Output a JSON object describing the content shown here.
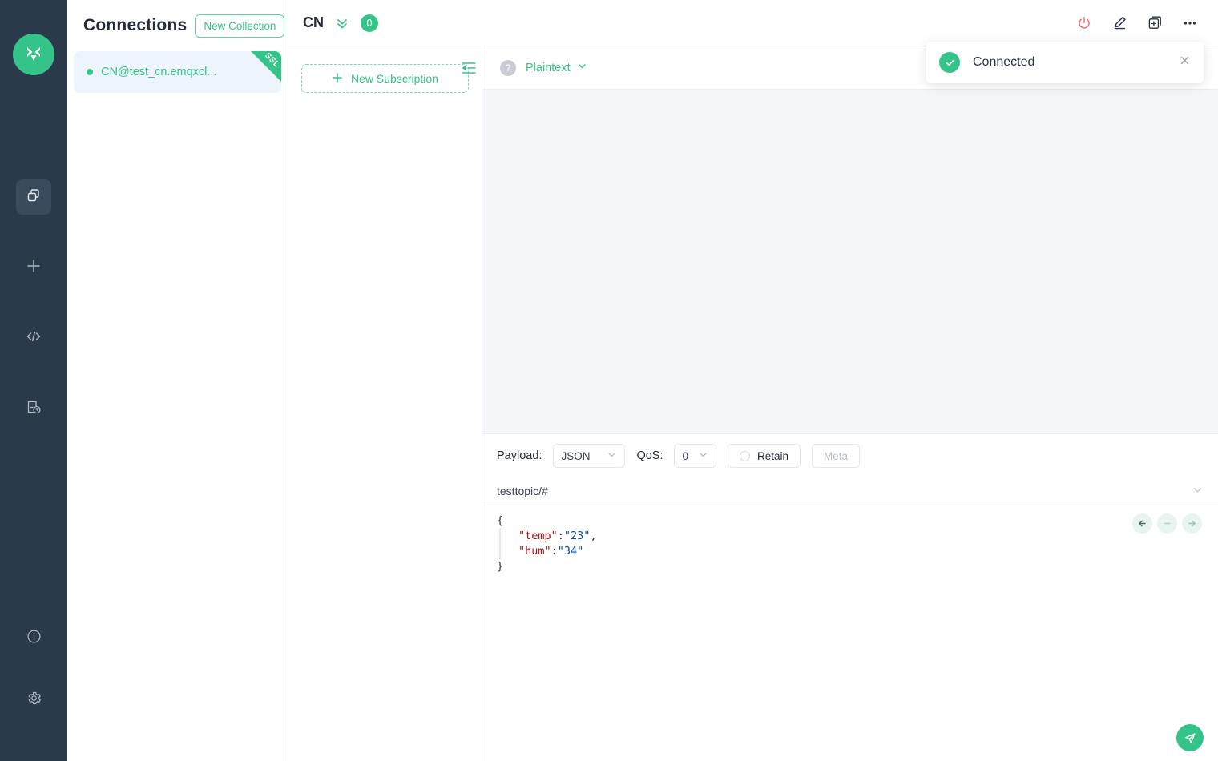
{
  "colors": {
    "brand_green": "#34c388",
    "rail_bg": "#2b3a4a",
    "danger_red": "#f56c6c",
    "message_bg": "#f5f6fa",
    "connection_item_bg": "#eef4fb"
  },
  "rail": {
    "logo_name": "mqttx-logo",
    "items": [
      {
        "icon": "connections-icon",
        "name": "rail-item-connections",
        "active": true
      },
      {
        "icon": "plus-icon",
        "name": "rail-item-new-connection",
        "active": false
      },
      {
        "icon": "code-icon",
        "name": "rail-item-scripts",
        "active": false
      },
      {
        "icon": "log-history-icon",
        "name": "rail-item-log",
        "active": false
      }
    ],
    "bottom_items": [
      {
        "icon": "info-icon",
        "name": "rail-item-about"
      },
      {
        "icon": "gear-icon",
        "name": "rail-item-settings"
      }
    ]
  },
  "connections": {
    "title": "Connections",
    "new_collection_label": "New Collection",
    "items": [
      {
        "name": "CN@test_cn.emqxcl...",
        "status": "connected",
        "badge": "SSL"
      }
    ]
  },
  "header": {
    "title": "CN",
    "chevron_icon": "double-chevron-down-icon",
    "badge_count": "0",
    "actions": [
      {
        "icon": "power-icon",
        "name": "disconnect-button"
      },
      {
        "icon": "pencil-icon",
        "name": "edit-connection-button"
      },
      {
        "icon": "new-window-icon",
        "name": "new-window-button"
      },
      {
        "icon": "ellipsis-icon",
        "name": "more-options-button"
      }
    ]
  },
  "subscriptions": {
    "new_subscription_label": "New Subscription",
    "collapse_icon": "collapse-left-icon"
  },
  "messages": {
    "help_icon": "help-icon",
    "format_label": "Plaintext",
    "format_chevron": "chevron-down-icon",
    "items": []
  },
  "publish": {
    "payload_label": "Payload:",
    "payload_value": "JSON",
    "qos_label": "QoS:",
    "qos_value": "0",
    "retain_label": "Retain",
    "retain_checked": false,
    "meta_label": "Meta",
    "meta_disabled": true,
    "topic": "testtopic/#",
    "topic_chevron": "chevron-down-icon",
    "editor": {
      "lines": [
        {
          "indent": false,
          "parts": [
            {
              "t": "{",
              "k": "punc"
            }
          ]
        },
        {
          "indent": true,
          "parts": [
            {
              "t": "\"temp\"",
              "k": "key"
            },
            {
              "t": ":",
              "k": "punc"
            },
            {
              "t": "\"23\"",
              "k": "str"
            },
            {
              "t": ",",
              "k": "punc"
            }
          ]
        },
        {
          "indent": true,
          "parts": [
            {
              "t": "\"hum\"",
              "k": "key"
            },
            {
              "t": ":",
              "k": "punc"
            },
            {
              "t": "\"34\"",
              "k": "str"
            }
          ]
        },
        {
          "indent": false,
          "parts": [
            {
              "t": "}",
              "k": "punc"
            }
          ]
        }
      ]
    },
    "nav_buttons": [
      {
        "icon": "arrow-left-icon",
        "name": "history-prev-button",
        "disabled": false
      },
      {
        "icon": "minus-icon",
        "name": "history-clear-button",
        "disabled": true
      },
      {
        "icon": "arrow-right-icon",
        "name": "history-next-button",
        "disabled": false
      }
    ],
    "send_icon": "send-icon"
  },
  "toast": {
    "icon": "check-circle-icon",
    "message": "Connected",
    "close_icon": "close-icon"
  }
}
